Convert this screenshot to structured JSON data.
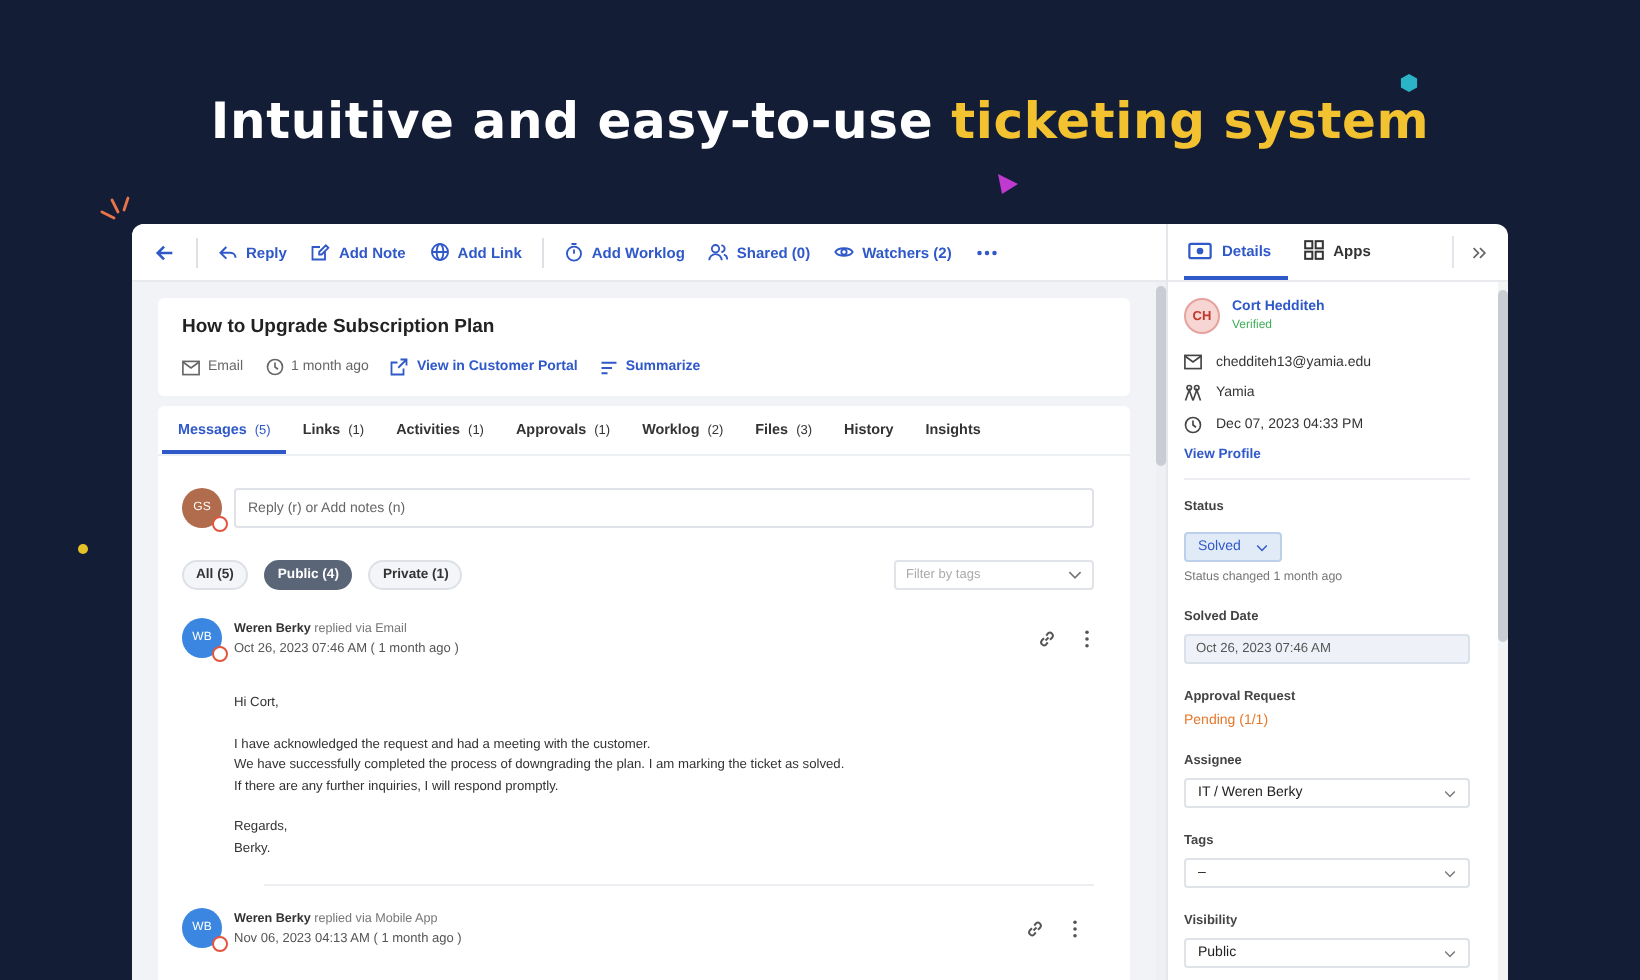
{
  "headline": {
    "text": "Intuitive and easy-to-use",
    "highlight": "ticketing system"
  },
  "toolbar": [
    {
      "kind": "back"
    },
    {
      "kind": "reply",
      "label": "Reply"
    },
    {
      "kind": "note",
      "label": "Add Note"
    },
    {
      "kind": "globe",
      "label": "Add Link"
    },
    {
      "kind": "timer",
      "label": "Add Worklog"
    },
    {
      "kind": "users",
      "label": "Shared (0)"
    },
    {
      "kind": "eye",
      "label": "Watchers (2)"
    },
    {
      "kind": "more"
    }
  ],
  "ticket": {
    "title": "How to Upgrade Subscription Plan",
    "channel": "Email",
    "age": "1 month ago",
    "portal_link": "View in Customer Portal",
    "summarize": "Summarize"
  },
  "tabs": [
    {
      "label": "Messages",
      "count": "(5)",
      "selected": true
    },
    {
      "label": "Links",
      "count": "(1)",
      "selected": false
    },
    {
      "label": "Activities",
      "count": "(1)",
      "selected": false
    },
    {
      "label": "Approvals",
      "count": "(1)",
      "selected": false
    },
    {
      "label": "Worklog",
      "count": "(2)",
      "selected": false
    },
    {
      "label": "Files",
      "count": "(3)",
      "selected": false
    },
    {
      "label": "History",
      "selected": false
    },
    {
      "label": "Insights",
      "selected": false
    }
  ],
  "reply_box": {
    "avatar": "GS",
    "placeholder": "Reply (r) or Add notes (n)"
  },
  "filters": [
    {
      "label": "All (5)",
      "selected": false
    },
    {
      "label": "Public (4)",
      "selected": true
    },
    {
      "label": "Private (1)",
      "selected": false
    }
  ],
  "tag_filter": {
    "placeholder": "Filter by tags"
  },
  "messages": [
    {
      "avatar": "WB",
      "author": "Weren Berky",
      "via": "replied via Email",
      "time": "Oct 26, 2023 07:46 AM ( 1 month ago )",
      "paragraphs": [
        [
          "Hi Cort,"
        ],
        [
          "I have acknowledged the request and had a meeting with the customer.",
          "We have successfully completed the process of downgrading the plan. I am marking the ticket as solved.",
          "If there are any further inquiries, I will respond promptly."
        ],
        [
          "Regards,",
          "Berky."
        ]
      ]
    },
    {
      "avatar": "WB",
      "author": "Weren Berky",
      "via": "replied via Mobile App",
      "time": "Nov 06, 2023 04:13 AM ( 1 month ago )"
    }
  ],
  "side_tabs": [
    {
      "kind": "card",
      "label": "Details",
      "selected": true
    },
    {
      "kind": "grid",
      "label": "Apps",
      "selected": false
    }
  ],
  "contact": {
    "initials": "CH",
    "name": "Cort Hedditeh",
    "verified": "Verified",
    "email": "chedditeh13@yamia.edu",
    "company": "Yamia",
    "date": "Dec 07, 2023 04:33 PM",
    "profile_link": "View Profile"
  },
  "fields": [
    {
      "kind": "status",
      "label": "Status",
      "value": "Solved",
      "note": "Status changed 1 month ago"
    },
    {
      "kind": "readonly",
      "label": "Solved Date",
      "value": "Oct 26, 2023 07:46 AM"
    },
    {
      "kind": "pending",
      "label": "Approval Request",
      "value": "Pending (1/1)"
    },
    {
      "kind": "select",
      "label": "Assignee",
      "value": "IT / Weren Berky"
    },
    {
      "kind": "select",
      "label": "Tags",
      "value": "–"
    },
    {
      "kind": "select",
      "label": "Visibility",
      "value": "Public"
    }
  ]
}
